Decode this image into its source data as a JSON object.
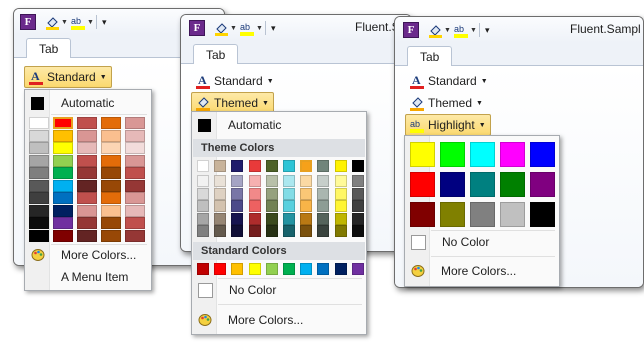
{
  "windows": [
    {
      "qat_title": "",
      "tab": "Tab",
      "button": "Standard"
    },
    {
      "qat_title": "Fluent.Sa",
      "tab": "Tab",
      "button": "Themed"
    },
    {
      "qat_title": "Fluent.Sampl",
      "tab": "Tab",
      "button": "Highlight"
    }
  ],
  "menu_standard": {
    "automatic": "Automatic",
    "more_colors": "More Colors...",
    "menu_item": "A Menu Item",
    "columns": [
      [
        "#ffffff",
        "#d8d8d8",
        "#bfbfbf",
        "#a5a5a5",
        "#7f7f7f",
        "#595959",
        "#3f3f3f",
        "#262626",
        "#0c0c0c",
        "#000000"
      ],
      [
        "#ff0000",
        "#ffc000",
        "#ffff00",
        "#92d050",
        "#00b050",
        "#00b0f0",
        "#0070c0",
        "#002060",
        "#7030a0",
        "#7f0000"
      ],
      [
        "#c0504d",
        "#d99694",
        "#e6b9b8",
        "#c0504d",
        "#953735",
        "#632423",
        "#c0504d",
        "#d99694",
        "#953735",
        "#632423"
      ],
      [
        "#e36c09",
        "#fabf8f",
        "#fcd5b4",
        "#e36c09",
        "#974806",
        "#984806",
        "#e36c09",
        "#fac08f",
        "#974806",
        "#984806"
      ],
      [
        "#d99795",
        "#e6b9b8",
        "#f2dcdb",
        "#d99795",
        "#c0504d",
        "#953735",
        "#d99795",
        "#e6b9b8",
        "#c0504d",
        "#953735"
      ]
    ]
  },
  "menu_themed": {
    "automatic": "Automatic",
    "theme_colors": "Theme Colors",
    "standard_colors": "Standard Colors",
    "no_color": "No Color",
    "more_colors": "More Colors...",
    "theme_top": [
      "#ffffff",
      "#c8b39a",
      "#1f1b6b",
      "#e83a3a",
      "#4e6228",
      "#2ec4d6",
      "#f6a11a",
      "#71857b",
      "#fff200",
      "#000000"
    ],
    "standard": [
      "#c00000",
      "#ff0000",
      "#ffc000",
      "#ffff00",
      "#92d050",
      "#00b050",
      "#00b0f0",
      "#0070c0",
      "#002060",
      "#7030a0"
    ]
  },
  "menu_highlight": {
    "no_color": "No Color",
    "more_colors": "More Colors...",
    "rows": [
      [
        "#ffff00",
        "#00ff00",
        "#00ffff",
        "#ff00ff",
        "#0000ff"
      ],
      [
        "#ff0000",
        "#000080",
        "#008080",
        "#008000",
        "#800080"
      ],
      [
        "#800000",
        "#808000",
        "#808080",
        "#c0c0c0",
        "#000000"
      ]
    ]
  }
}
